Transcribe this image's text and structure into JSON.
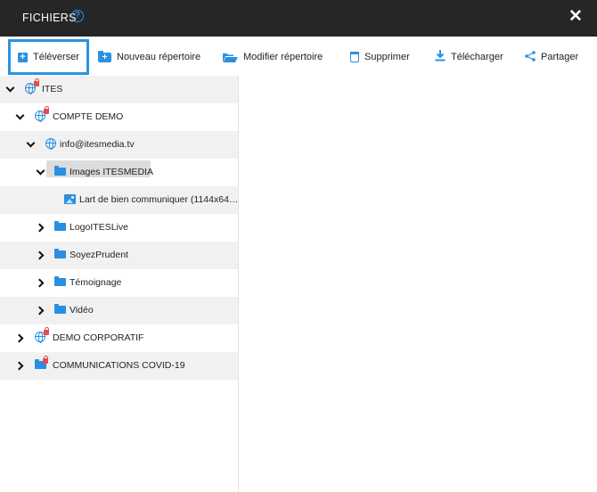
{
  "dialog": {
    "title": "FICHIERS",
    "help_icon": "question-circle-icon",
    "close_icon": "close-icon"
  },
  "toolbar": {
    "upload": "Téléverser",
    "new_folder": "Nouveau répertoire",
    "edit_folder": "Modifier répertoire",
    "delete": "Supprimer",
    "download": "Télécharger",
    "share": "Partager"
  },
  "tree": {
    "nodes": [
      {
        "label": "ITES",
        "icon": "globe-lock-icon",
        "expanded": true
      },
      {
        "label": "COMPTE DEMO",
        "icon": "globe-lock-icon",
        "expanded": true
      },
      {
        "label": "info@itesmedia.tv",
        "icon": "globe-icon",
        "expanded": true
      },
      {
        "label": "Images ITESMEDIA",
        "icon": "folder-icon",
        "expanded": true,
        "selected": true
      },
      {
        "label": "Lart de bien communiquer (1144x64…",
        "icon": "image-icon"
      },
      {
        "label": "LogoITESLive",
        "icon": "folder-icon",
        "expanded": false
      },
      {
        "label": "SoyezPrudent",
        "icon": "folder-icon",
        "expanded": false
      },
      {
        "label": "Témoignage",
        "icon": "folder-icon",
        "expanded": false
      },
      {
        "label": "Vidéo",
        "icon": "folder-icon",
        "expanded": false
      },
      {
        "label": "DEMO CORPORATIF",
        "icon": "globe-lock-icon",
        "expanded": false
      },
      {
        "label": "COMMUNICATIONS COVID-19",
        "icon": "folder-lock-icon",
        "expanded": false
      }
    ]
  },
  "colors": {
    "titlebar": "#262626",
    "accent": "#2a8fe0",
    "lock": "#e64b4b",
    "row_shade": "#f1f1f1",
    "selection": "#dcdcdc"
  }
}
